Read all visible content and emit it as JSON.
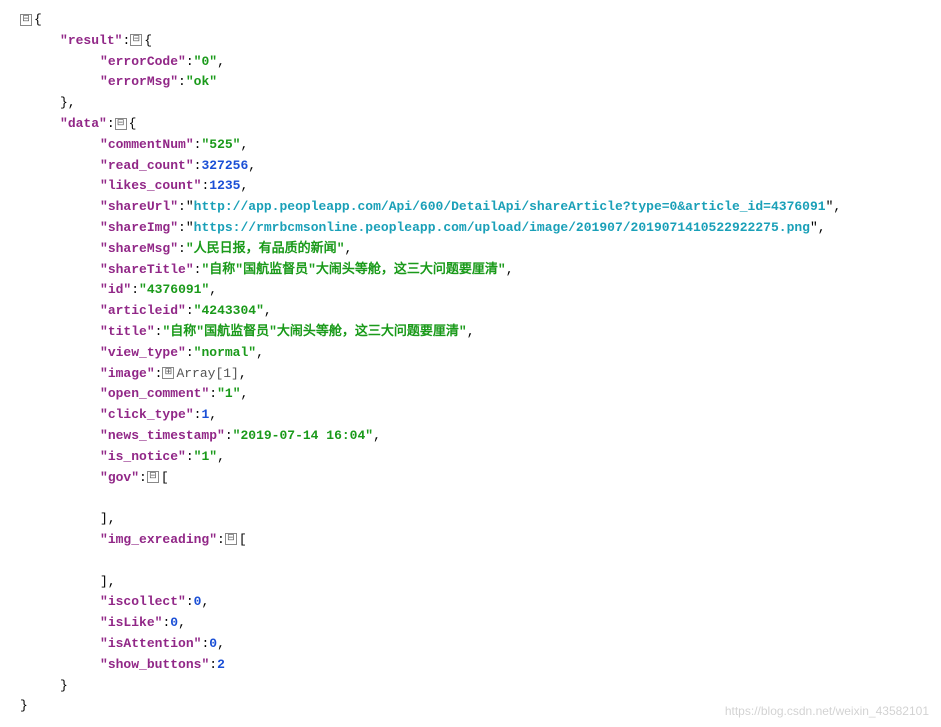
{
  "icons": {
    "minus": "⊟",
    "plus": "⊞"
  },
  "watermark": "https://blog.csdn.net/weixin_43582101",
  "json": {
    "result": {
      "errorCode": "0",
      "errorMsg": "ok"
    },
    "data": {
      "commentNum": "525",
      "read_count": 327256,
      "likes_count": 1235,
      "shareUrl": "http://app.peopleapp.com/Api/600/DetailApi/shareArticle?type=0&article_id=4376091",
      "shareImg": "https://rmrbcmsonline.peopleapp.com/upload/image/201907/2019071410522922275.png",
      "shareMsg": "人民日报，有品质的新闻",
      "shareTitle": "自称\"国航监督员\"大闹头等舱，这三大问题要厘清",
      "id": "4376091",
      "articleid": "4243304",
      "title": "自称\"国航监督员\"大闹头等舱，这三大问题要厘清",
      "view_type": "normal",
      "image_label": "Array[1]",
      "open_comment": "1",
      "click_type": 1,
      "news_timestamp": "2019-07-14 16:04",
      "is_notice": "1",
      "gov": [],
      "img_exreading": [],
      "iscollect": 0,
      "isLike": 0,
      "isAttention": 0,
      "show_buttons": 2
    }
  },
  "keys": {
    "result": "result",
    "errorCode": "errorCode",
    "errorMsg": "errorMsg",
    "data": "data",
    "commentNum": "commentNum",
    "read_count": "read_count",
    "likes_count": "likes_count",
    "shareUrl": "shareUrl",
    "shareImg": "shareImg",
    "shareMsg": "shareMsg",
    "shareTitle": "shareTitle",
    "id": "id",
    "articleid": "articleid",
    "title": "title",
    "view_type": "view_type",
    "image": "image",
    "open_comment": "open_comment",
    "click_type": "click_type",
    "news_timestamp": "news_timestamp",
    "is_notice": "is_notice",
    "gov": "gov",
    "img_exreading": "img_exreading",
    "iscollect": "iscollect",
    "isLike": "isLike",
    "isAttention": "isAttention",
    "show_buttons": "show_buttons"
  }
}
